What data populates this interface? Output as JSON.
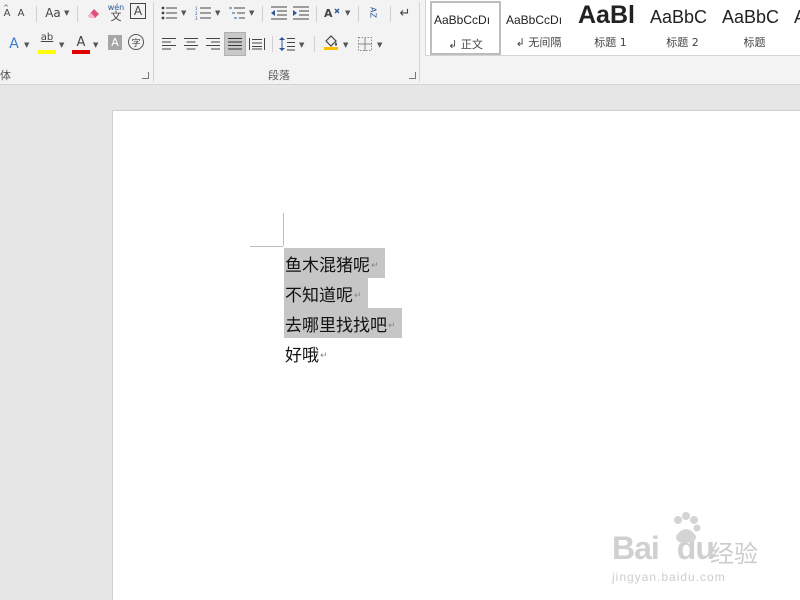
{
  "font_group": {
    "shrink_font_glyph": "A",
    "change_case_glyph": "Aa",
    "clear_formatting_icon": "eraser-icon",
    "phonetic_guide_top": "wén",
    "phonetic_guide_bottom": "文",
    "char_border_glyph": "A",
    "text_effects_glyph": "A",
    "highlight_glyph": "ab",
    "font_color_glyph": "A",
    "char_shading_glyph": "A",
    "enclose_char_glyph": "字",
    "label": "体",
    "accent_colors": {
      "highlight": "#ffff00",
      "font_color": "#e00000"
    }
  },
  "paragraph_group": {
    "label": "段落",
    "sort_glyph": "AZ",
    "show_marks_glyph": "↵"
  },
  "styles_group": {
    "items": [
      {
        "preview": "AaBbCcDı",
        "name": "↲ 正文",
        "active": true
      },
      {
        "preview": "AaBbCcDı",
        "name": "↲ 无间隔",
        "active": false
      },
      {
        "preview": "AaBl",
        "name": "标题 1",
        "active": false
      },
      {
        "preview": "AaBbC",
        "name": "标题 2",
        "active": false
      },
      {
        "preview": "AaBbC",
        "name": "标题",
        "active": false
      },
      {
        "preview": "A",
        "name": "",
        "active": false
      }
    ]
  },
  "document": {
    "lines": [
      {
        "text": "鱼木混猪呢",
        "selected": true
      },
      {
        "text": "不知道呢",
        "selected": true
      },
      {
        "text": "去哪里找找吧",
        "selected": true
      },
      {
        "text": "好哦",
        "selected": false
      }
    ],
    "paragraph_mark": "↵",
    "selection_color": "#c6c6c6"
  },
  "watermark": {
    "logo_text": "Bai",
    "logo_text_2": "du",
    "cn_text": "经验",
    "url": "jingyan.baidu.com"
  }
}
